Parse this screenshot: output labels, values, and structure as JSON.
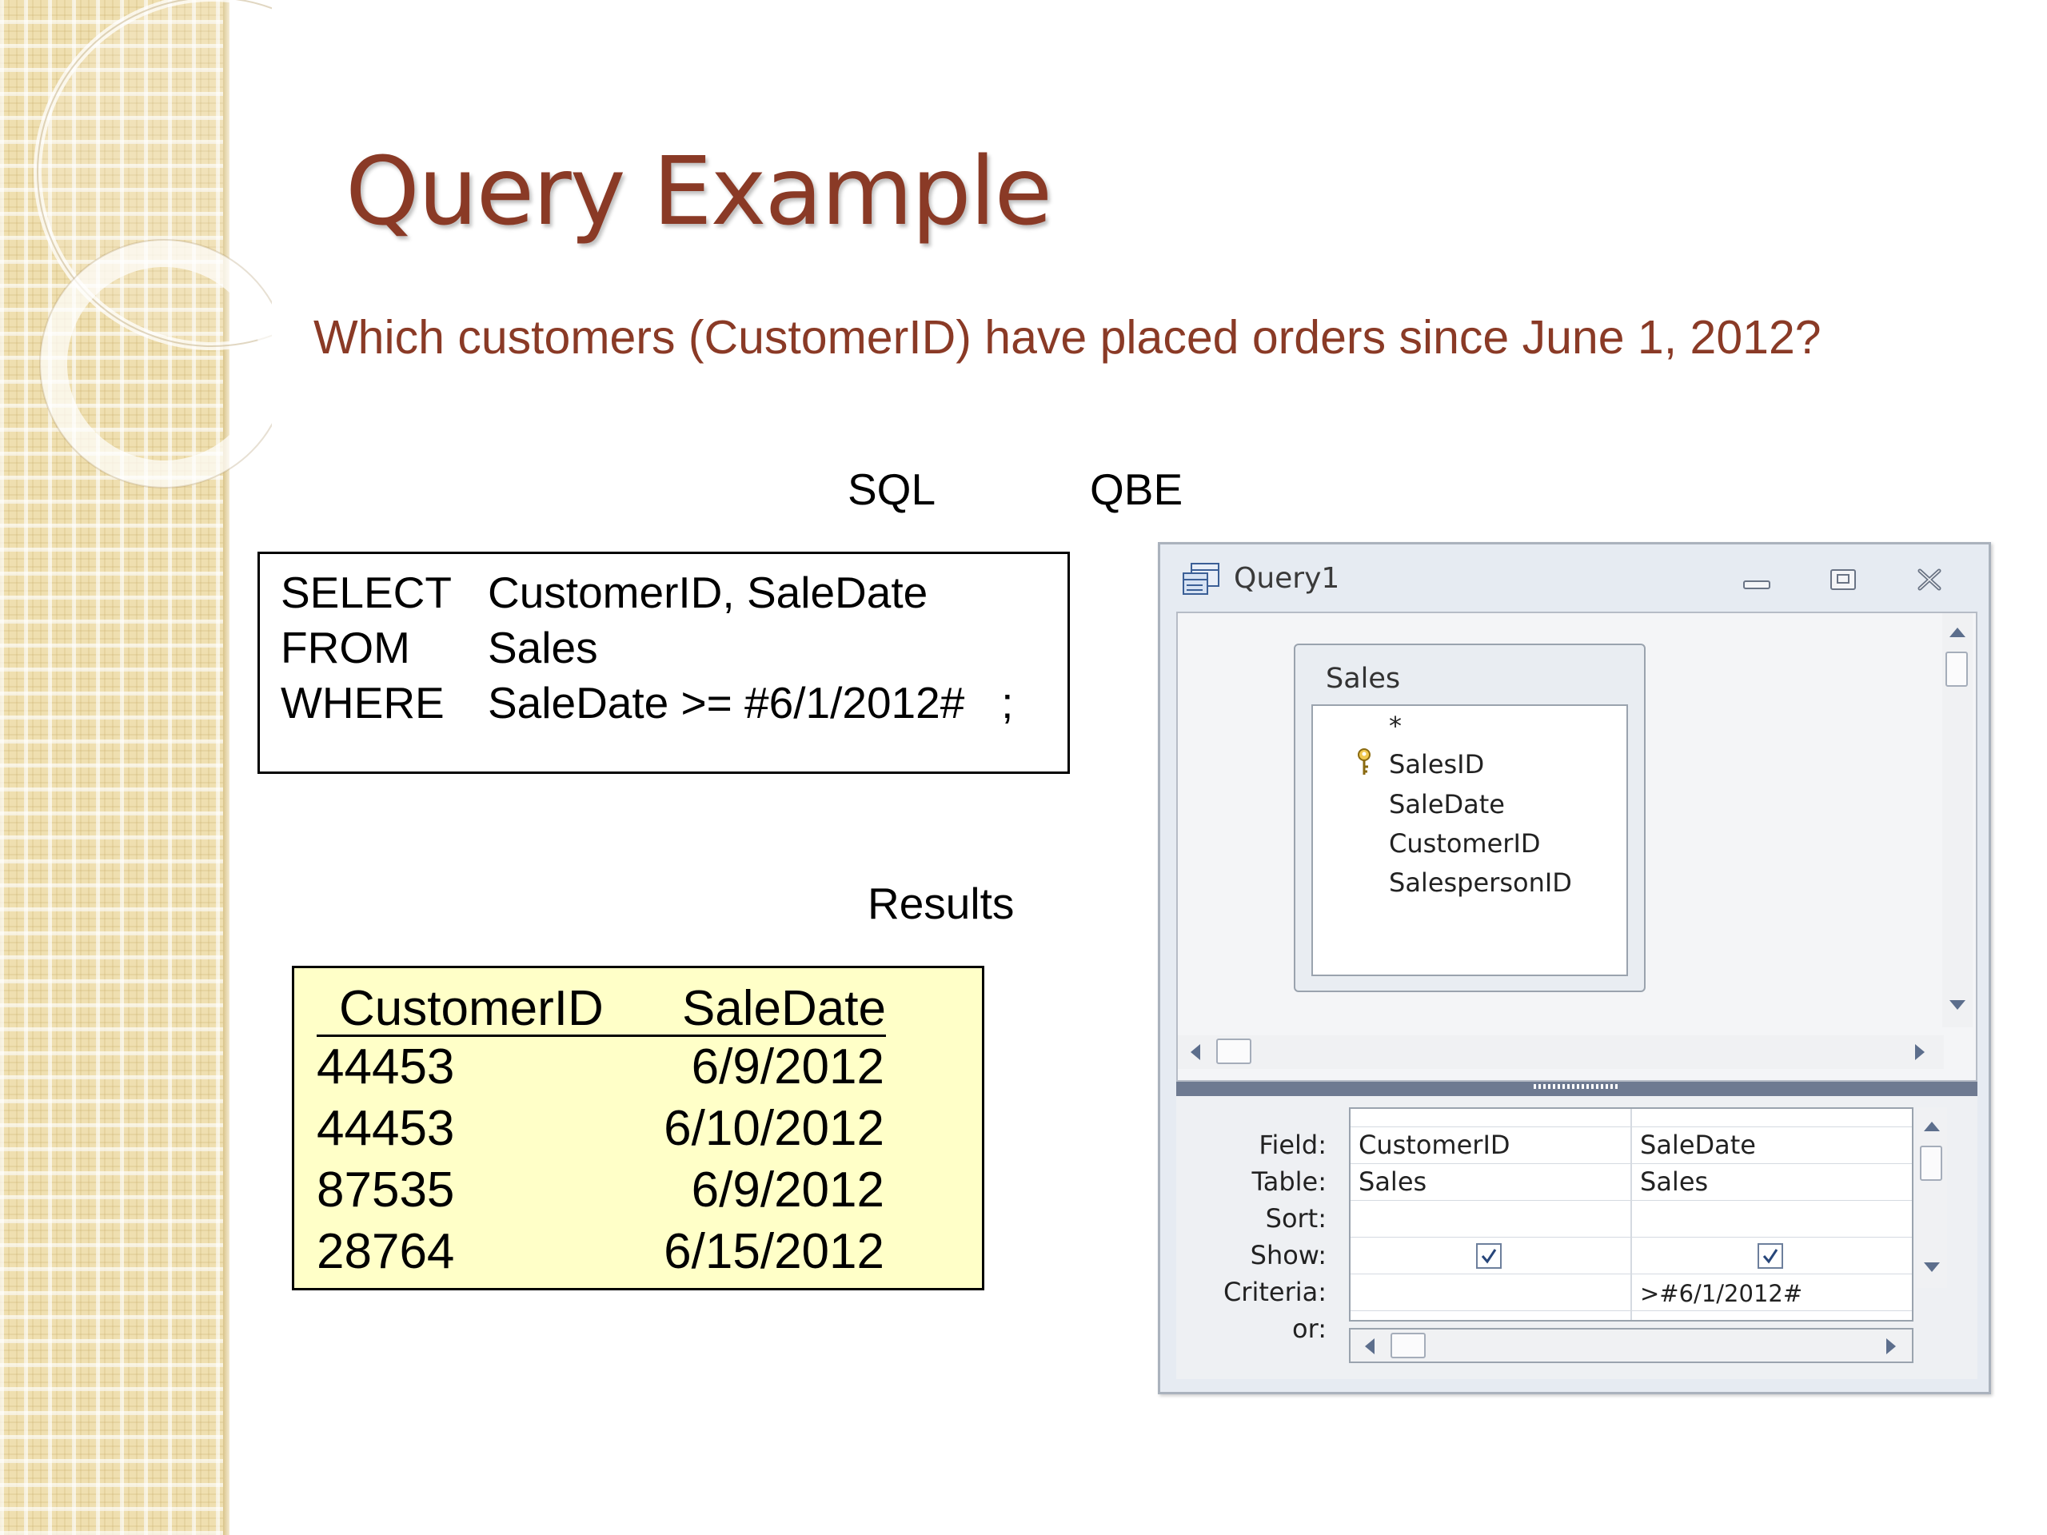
{
  "slide": {
    "title": "Query Example",
    "question": "Which customers (CustomerID) have placed orders since June 1, 2012?",
    "label_sql": "SQL",
    "label_qbe": "QBE",
    "label_results": "Results"
  },
  "sql": {
    "lines": [
      {
        "keyword": "SELECT",
        "value": "CustomerID, SaleDate"
      },
      {
        "keyword": "FROM",
        "value": "Sales"
      },
      {
        "keyword": "WHERE",
        "value": "SaleDate >= #6/1/2012#   ;"
      }
    ]
  },
  "results": {
    "headers": [
      "CustomerID",
      "SaleDate"
    ],
    "rows": [
      [
        "44453",
        "6/9/2012"
      ],
      [
        "44453",
        "6/10/2012"
      ],
      [
        "87535",
        "6/9/2012"
      ],
      [
        "28764",
        "6/15/2012"
      ]
    ]
  },
  "qbe_window": {
    "title": "Query1",
    "icon": "query-design-icon",
    "table": {
      "name": "Sales",
      "fields": [
        "*",
        "SalesID",
        "SaleDate",
        "CustomerID",
        "SalespersonID"
      ],
      "key_field": "SalesID"
    },
    "grid": {
      "row_labels": [
        "Field:",
        "Table:",
        "Sort:",
        "Show:",
        "Criteria:",
        "or:"
      ],
      "columns": [
        {
          "field": "CustomerID",
          "table": "Sales",
          "sort": "",
          "show": true,
          "criteria": "",
          "or": ""
        },
        {
          "field": "SaleDate",
          "table": "Sales",
          "sort": "",
          "show": true,
          "criteria": ">#6/1/2012#",
          "or": ""
        }
      ]
    }
  },
  "colors": {
    "title": "#8a3a26",
    "results_bg": "#ffffc8",
    "band": "#efdfb0"
  }
}
